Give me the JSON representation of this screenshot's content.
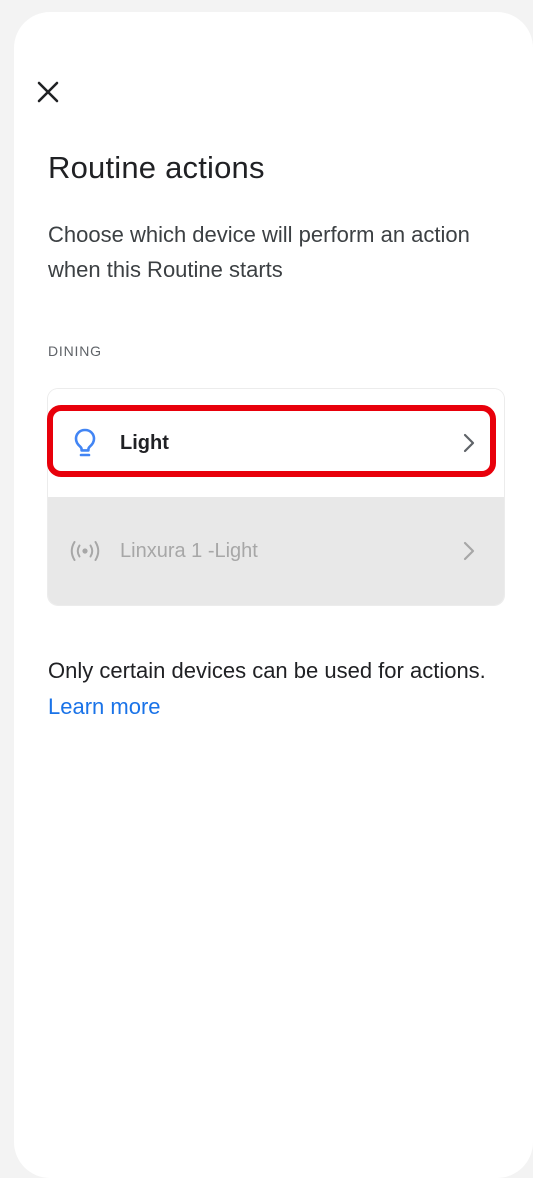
{
  "header": {
    "close_icon": "close-icon",
    "title": "Routine actions",
    "subtitle": "Choose which device will perform an action when this Routine starts"
  },
  "section": {
    "label": "DINING"
  },
  "devices": [
    {
      "name": "Light",
      "icon": "lightbulb-icon",
      "enabled": true,
      "highlighted": true,
      "icon_color": "#4285f4"
    },
    {
      "name": "Linxura 1 -Light",
      "icon": "wireless-signal-icon",
      "enabled": false,
      "highlighted": false
    }
  ],
  "footer": {
    "note": "Only certain devices can be used for actions.",
    "link": "Learn more",
    "link_color": "#1a73e8"
  },
  "highlight_color": "#e8000b"
}
